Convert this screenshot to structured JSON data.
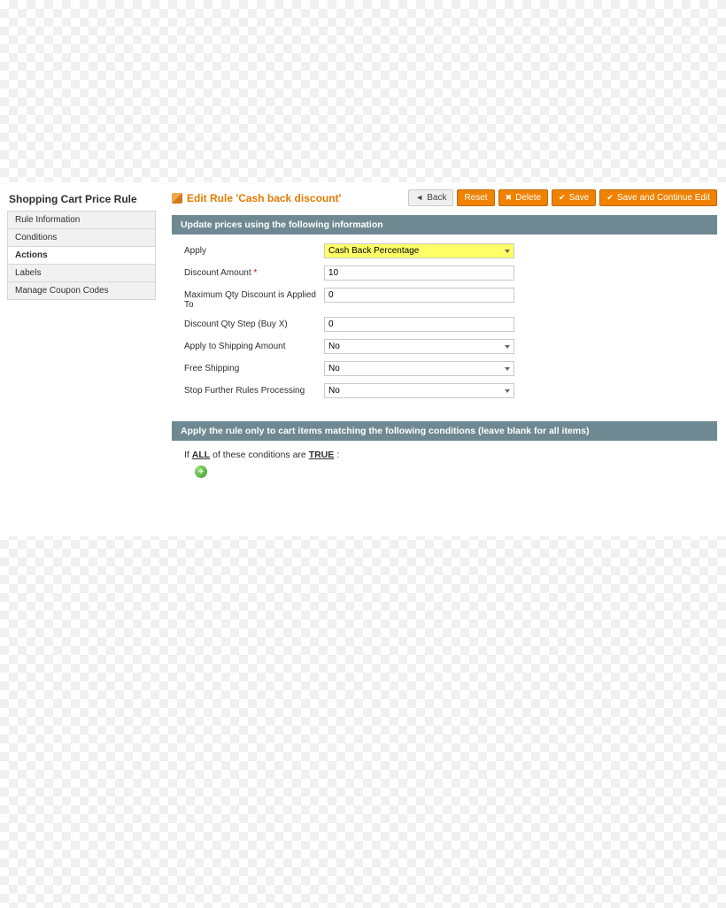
{
  "sidebar": {
    "title": "Shopping Cart Price Rule",
    "items": [
      {
        "label": "Rule Information",
        "active": false
      },
      {
        "label": "Conditions",
        "active": false
      },
      {
        "label": "Actions",
        "active": true
      },
      {
        "label": "Labels",
        "active": false
      },
      {
        "label": "Manage Coupon Codes",
        "active": false
      }
    ]
  },
  "header": {
    "title": "Edit Rule 'Cash back discount'",
    "buttons": {
      "back": "Back",
      "reset": "Reset",
      "delete": "Delete",
      "save": "Save",
      "save_continue": "Save and Continue Edit"
    }
  },
  "section1": {
    "title": "Update prices using the following information",
    "fields": {
      "apply": {
        "label": "Apply",
        "value": "Cash Back Percentage"
      },
      "discount_amount": {
        "label": "Discount Amount",
        "required": true,
        "value": "10"
      },
      "max_qty": {
        "label": "Maximum Qty Discount is Applied To",
        "value": "0"
      },
      "qty_step": {
        "label": "Discount Qty Step (Buy X)",
        "value": "0"
      },
      "apply_shipping": {
        "label": "Apply to Shipping Amount",
        "value": "No"
      },
      "free_shipping": {
        "label": "Free Shipping",
        "value": "No"
      },
      "stop_rules": {
        "label": "Stop Further Rules Processing",
        "value": "No"
      }
    }
  },
  "section2": {
    "title": "Apply the rule only to cart items matching the following conditions (leave blank for all items)",
    "cond_prefix": "If",
    "cond_all": "ALL",
    "cond_mid": "of these conditions are",
    "cond_true": "TRUE",
    "cond_suffix": ":"
  }
}
